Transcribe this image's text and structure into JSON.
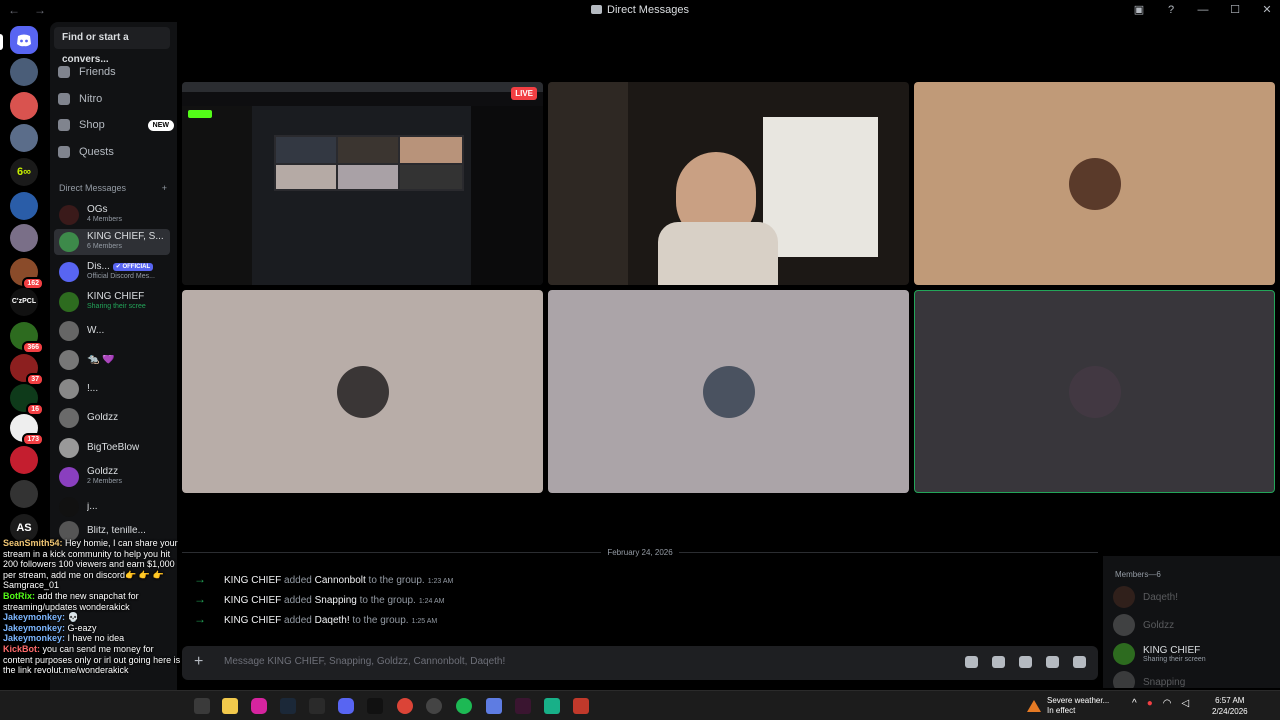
{
  "window": {
    "title": "Direct Messages"
  },
  "sidebar": {
    "search_placeholder": "Find or start a convers...",
    "nav": [
      {
        "label": "Friends"
      },
      {
        "label": "Nitro"
      },
      {
        "label": "Shop",
        "badge": "NEW"
      },
      {
        "label": "Quests"
      }
    ],
    "dm_header": "Direct Messages",
    "dm_add": "+",
    "dms": [
      {
        "name": "OGs",
        "sub": "4 Members"
      },
      {
        "name": "KING CHIEF, S...",
        "sub": "6 Members"
      },
      {
        "name": "Dis...",
        "badge": "✔ OFFICIAL",
        "sub": "Official Discord Mes..."
      },
      {
        "name": "KING CHIEF",
        "sub": "Sharing their scree"
      },
      {
        "name": "W...",
        "sub": ""
      },
      {
        "name": "🐀 💜",
        "sub": ""
      },
      {
        "name": "!...",
        "sub": ""
      },
      {
        "name": "Goldzz",
        "sub": ""
      },
      {
        "name": "BigToeBlow",
        "sub": ""
      },
      {
        "name": "Goldzz",
        "sub": "2 Members"
      },
      {
        "name": "j...",
        "sub": ""
      },
      {
        "name": "Blitz, tenille...",
        "sub": ""
      }
    ]
  },
  "servers": {
    "badges": [
      "162",
      "366",
      "37",
      "16",
      "173"
    ],
    "labels": [
      "C'zPCL",
      "AS"
    ]
  },
  "stream_overlay": {
    "live_label": "LIVE",
    "messages": [
      {
        "user": "SeanSmith54:",
        "text": " Hey homie, I can share your stream in a kick community to help you hit 200 followers 100 viewers and earn $1,000 per stream, add me on discord👉 👉 👉 Samgrace_01",
        "cls": "u-sean"
      },
      {
        "user": "BotRix:",
        "text": " add the new snapchat for streaming/updates wonderakick",
        "cls": "u-bot"
      },
      {
        "user": "Jakeymonkey:",
        "text": " 💀",
        "cls": "u-jake"
      },
      {
        "user": "Jakeymonkey:",
        "text": " G-eazy",
        "cls": "u-jake"
      },
      {
        "user": "Jakeymonkey:",
        "text": " I have no idea",
        "cls": "u-jake"
      },
      {
        "user": "KickBot:",
        "text": " you can send me money for content purposes only or irl out going here is the link revolut.me/wonderakick",
        "cls": "u-kick"
      }
    ]
  },
  "chat": {
    "date": "February 24, 2026",
    "events": [
      {
        "actor": "KING CHIEF",
        "verb": " added ",
        "target": "Cannonbolt",
        "tail": " to the group.",
        "time": "1:23 AM"
      },
      {
        "actor": "KING CHIEF",
        "verb": " added ",
        "target": "Snapping",
        "tail": " to the group.",
        "time": "1:24 AM"
      },
      {
        "actor": "KING CHIEF",
        "verb": " added ",
        "target": "Daqeth!",
        "tail": " to the group.",
        "time": "1:25 AM"
      }
    ],
    "composer_placeholder": "Message KING CHIEF, Snapping, Goldzz, Cannonbolt, Daqeth!"
  },
  "members": {
    "header": "Members—6",
    "list": [
      {
        "name": "Daqeth!",
        "sub": "",
        "dim": true
      },
      {
        "name": "Goldzz",
        "sub": "",
        "dim": true
      },
      {
        "name": "KING CHIEF",
        "sub": "Sharing their screen",
        "dim": false
      },
      {
        "name": "Snapping",
        "sub": "",
        "dim": true
      }
    ]
  },
  "taskbar": {
    "weather_line1": "Severe weather...",
    "weather_line2": "In effect",
    "time": "6:57 AM",
    "date": "2/24/2026"
  },
  "colors": {
    "accent": "#5865f2",
    "online": "#23a559",
    "danger": "#f23f43",
    "kick_green": "#53fc18"
  }
}
